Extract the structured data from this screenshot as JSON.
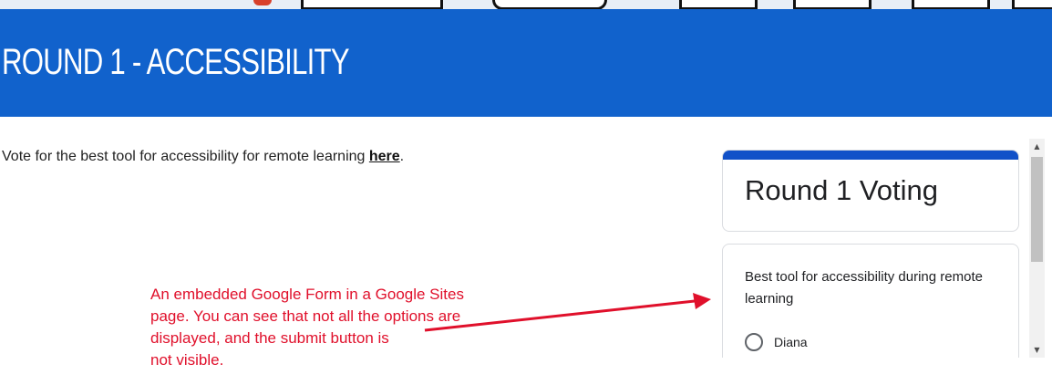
{
  "header": {
    "title": "ROUND 1 - ACCESSIBILITY"
  },
  "intro": {
    "text": "Vote for the best tool for accessibility for remote learning ",
    "link_label": "here",
    "suffix": "."
  },
  "annotation": {
    "lines": [
      "An embedded Google Form in a Google Sites",
      "page. You can see that not all the options are",
      "displayed, and the submit button is",
      "not visible."
    ]
  },
  "form": {
    "title": "Round 1 Voting",
    "question": "Best tool for accessibility during remote learning",
    "options": [
      "Diana"
    ]
  },
  "colors": {
    "header_bg": "#1162cc",
    "form_accent": "#1151c8",
    "annotation": "#e0102b"
  },
  "icons": {
    "scroll_up": "▲",
    "scroll_down": "▼"
  }
}
